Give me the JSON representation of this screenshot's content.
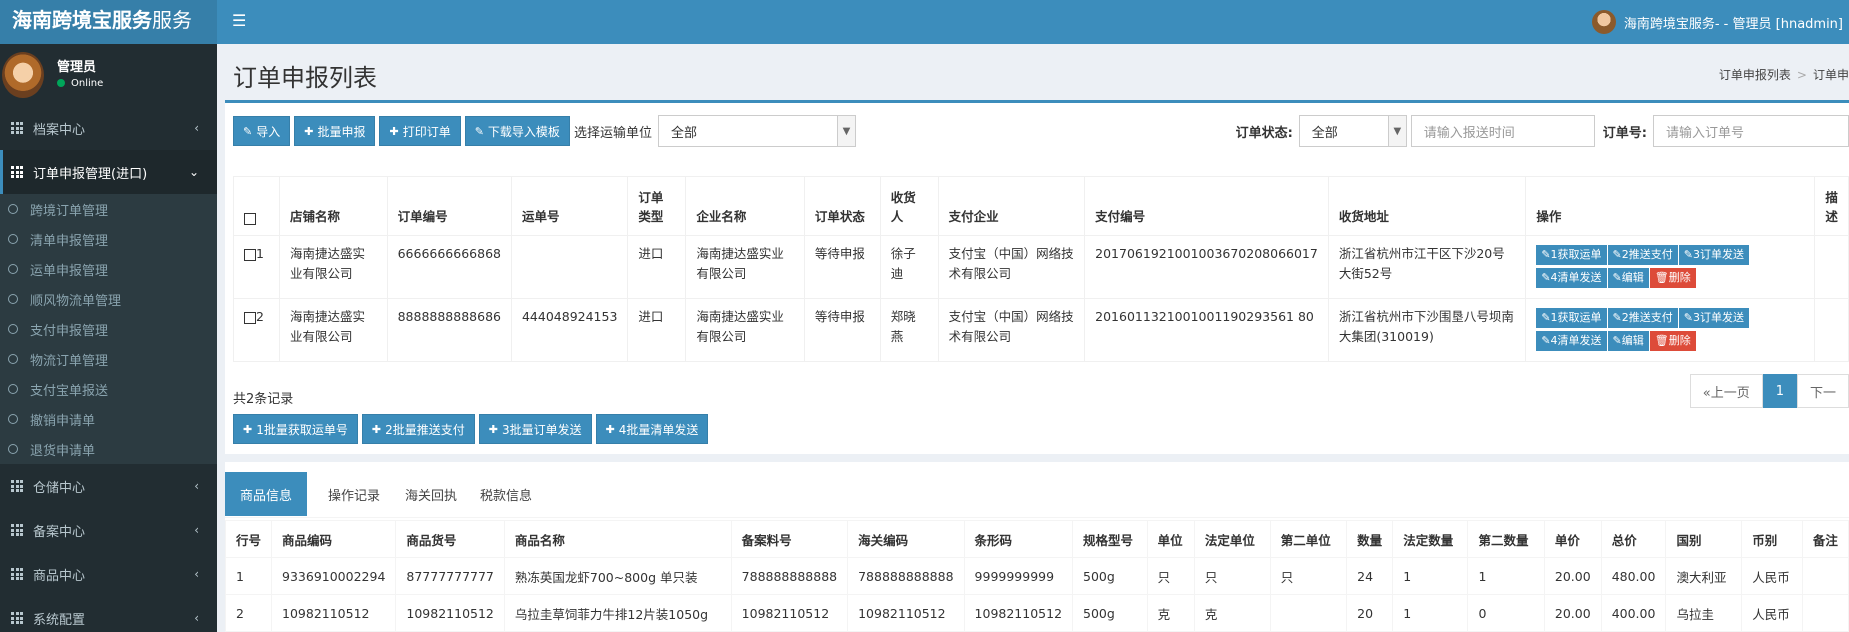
{
  "app": {
    "brand_bold": "海南跨境宝服务",
    "brand_light": "服务",
    "user_label": "海南跨境宝服务- - 管理员 [hnadmin]"
  },
  "sidebar": {
    "user_name": "管理员",
    "user_status": "Online",
    "menus": {
      "archive": "档案中心",
      "order_decl": "订单申报管理(进口)",
      "warehouse": "仓储中心",
      "filing": "备案中心",
      "goods": "商品中心",
      "system": "系统配置"
    },
    "subitems": [
      "跨境订单管理",
      "清单申报管理",
      "运单申报管理",
      "顺风物流单管理",
      "支付申报管理",
      "物流订单管理",
      "支付宝单报送",
      "撤销申请单",
      "退货申请单"
    ]
  },
  "page": {
    "title": "订单申报列表",
    "breadcrumb_1": "订单申报列表",
    "breadcrumb_sep": ">",
    "breadcrumb_2": "订单申"
  },
  "toolbar": {
    "import": "导入",
    "batch_declare": "批量申报",
    "print_order": "打印订单",
    "download_template": "下载导入模板",
    "carrier_label": "选择运输单位",
    "carrier_value": "全部",
    "status_label": "订单状态:",
    "status_value": "全部",
    "date_placeholder": "请输入报送时间",
    "order_no_label": "订单号:",
    "order_no_placeholder": "请输入订单号"
  },
  "orders_table": {
    "headers": [
      "店铺名称",
      "订单编号",
      "运单号",
      "订单类型",
      "企业名称",
      "订单状态",
      "收货人",
      "支付企业",
      "支付编号",
      "收货地址",
      "操作",
      "描述"
    ],
    "rows": [
      {
        "idx": "1",
        "shop": "海南捷达盛实业有限公司",
        "order_no": "6666666666868",
        "waybill": "",
        "type": "进口",
        "company": "海南捷达盛实业有限公司",
        "status": "等待申报",
        "receiver": "徐子迪",
        "pay_company": "支付宝（中国）网络技术有限公司",
        "pay_no": "2017061921001003670208066017",
        "address": "浙江省杭州市江干区下沙20号大街52号"
      },
      {
        "idx": "2",
        "shop": "海南捷达盛实业有限公司",
        "order_no": "8888888888686",
        "waybill": "444048924153",
        "type": "进口",
        "company": "海南捷达盛实业有限公司",
        "status": "等待申报",
        "receiver": "郑晓燕",
        "pay_company": "支付宝（中国）网络技术有限公司",
        "pay_no": "2016011321001001190293561 80",
        "address": "浙江省杭州市下沙围垦八号坝南大集团(310019)"
      }
    ],
    "actions": {
      "get_waybill": "1获取运单",
      "push_pay": "2推送支付",
      "send_order": "3订单发送",
      "send_list": "4清单发送",
      "edit": "编辑",
      "delete": "删除"
    }
  },
  "summary": "共2条记录",
  "pager": {
    "prev": "«上一页",
    "current": "1",
    "next": "下一"
  },
  "bulk": {
    "b1": "1批量获取运单号",
    "b2": "2批量推送支付",
    "b3": "3批量订单发送",
    "b4": "4批量清单发送"
  },
  "tabs": [
    "商品信息",
    "操作记录",
    "海关回执",
    "税款信息"
  ],
  "items_table": {
    "headers": [
      "行号",
      "商品编码",
      "商品货号",
      "商品名称",
      "备案料号",
      "海关编码",
      "条形码",
      "规格型号",
      "单位",
      "法定单位",
      "第二单位",
      "数量",
      "法定数量",
      "第二数量",
      "单价",
      "总价",
      "国别",
      "币别",
      "备注"
    ],
    "rows": [
      [
        "1",
        "9336910002294",
        "87777777777",
        "熟冻英国龙虾700~800g 单只装",
        "788888888888",
        "788888888888",
        "9999999999",
        "500g",
        "只",
        "只",
        "只",
        "24",
        "1",
        "1",
        "20.00",
        "480.00",
        "澳大利亚",
        "人民币",
        ""
      ],
      [
        "2",
        "10982110512",
        "10982110512",
        "乌拉圭草饲菲力牛排12片装1050g",
        "10982110512",
        "10982110512",
        "10982110512",
        "500g",
        "克",
        "克",
        "",
        "20",
        "1",
        "0",
        "20.00",
        "400.00",
        "乌拉圭",
        "人民币",
        ""
      ]
    ]
  }
}
